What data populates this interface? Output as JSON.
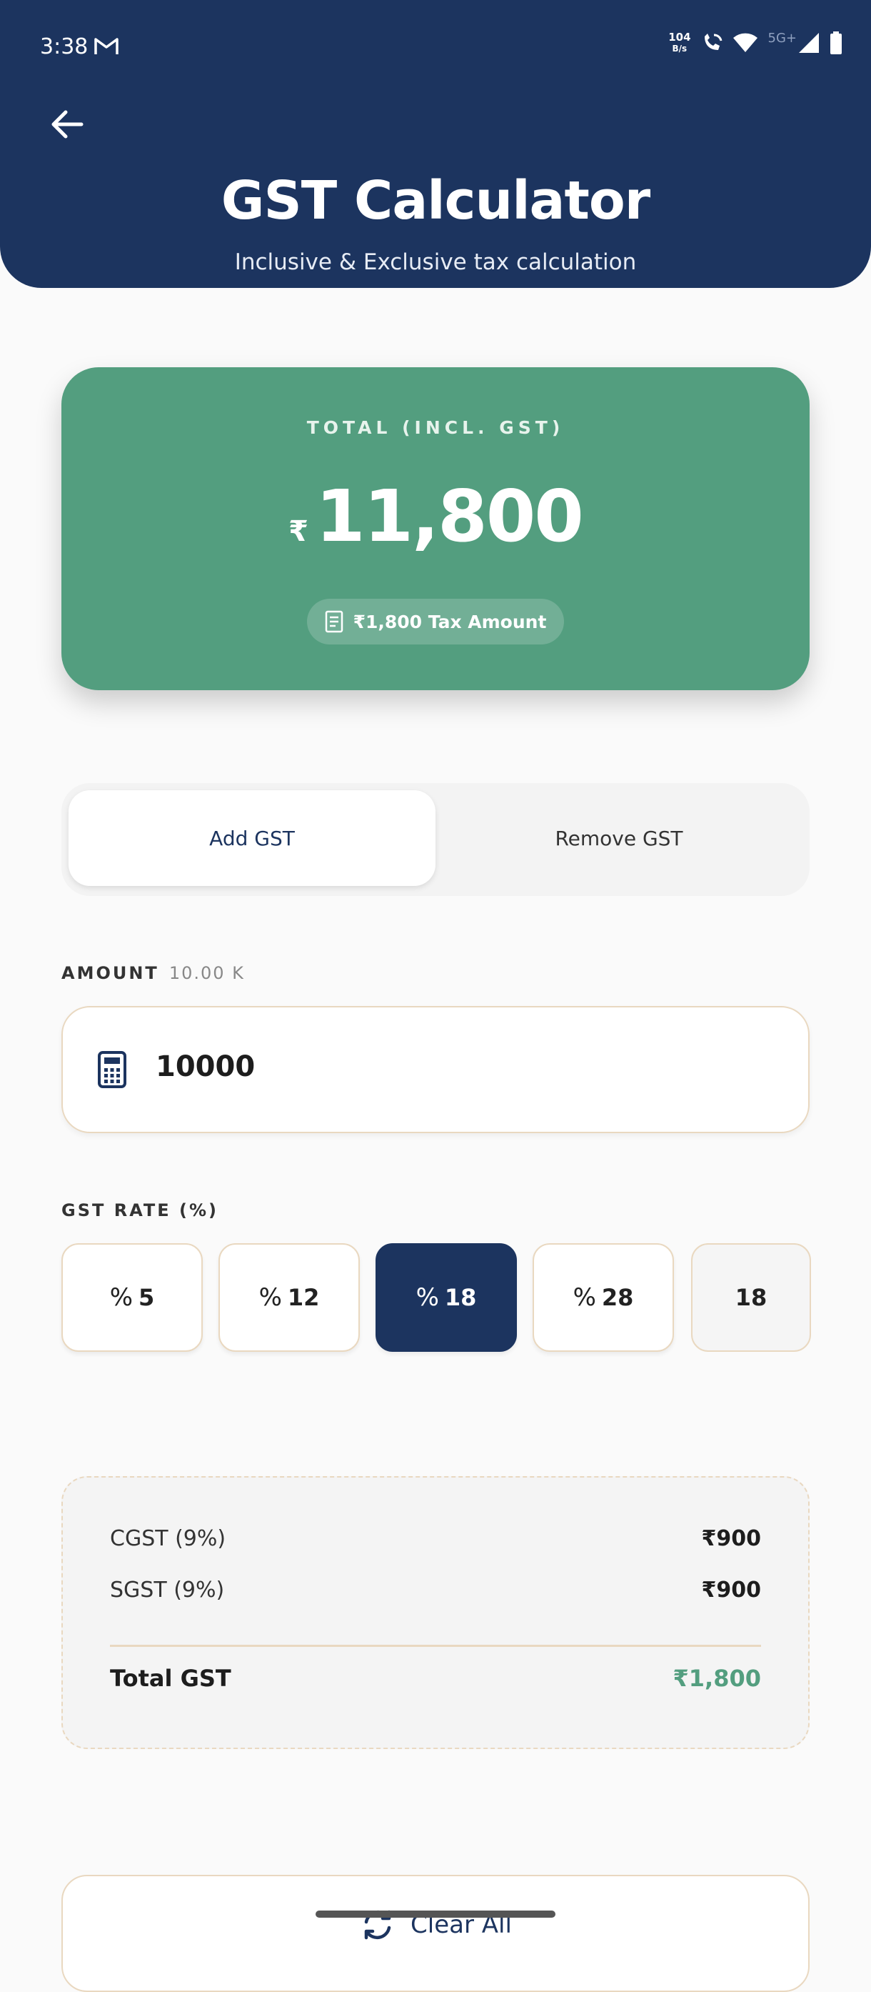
{
  "status_bar": {
    "time": "3:38",
    "net_speed_value": "104",
    "net_speed_unit": "B/s",
    "network_label": "5G+"
  },
  "header": {
    "title": "GST Calculator",
    "subtitle": "Inclusive & Exclusive tax calculation"
  },
  "summary": {
    "label": "TOTAL (INCL. GST)",
    "currency_symbol": "₹",
    "total": "11,800",
    "tax_pill": "₹1,800 Tax Amount"
  },
  "mode_toggle": {
    "add_label": "Add GST",
    "remove_label": "Remove GST",
    "selected": "Add GST"
  },
  "amount": {
    "label": "AMOUNT",
    "hint": "10.00 K",
    "value": "10000"
  },
  "gst_rate": {
    "label": "GST RATE (%)",
    "options": [
      "5",
      "12",
      "18",
      "28"
    ],
    "custom_value": "18",
    "selected": "18"
  },
  "breakdown": {
    "cgst_label": "CGST (9%)",
    "cgst_value": "₹900",
    "sgst_label": "SGST (9%)",
    "sgst_value": "₹900",
    "total_label": "Total GST",
    "total_value": "₹1,800"
  },
  "actions": {
    "clear_label": "Clear All"
  },
  "colors": {
    "header": "#1c345f",
    "accent_green": "#539e7f",
    "border_beige": "#e9d8c0",
    "background": "#fafafa"
  }
}
